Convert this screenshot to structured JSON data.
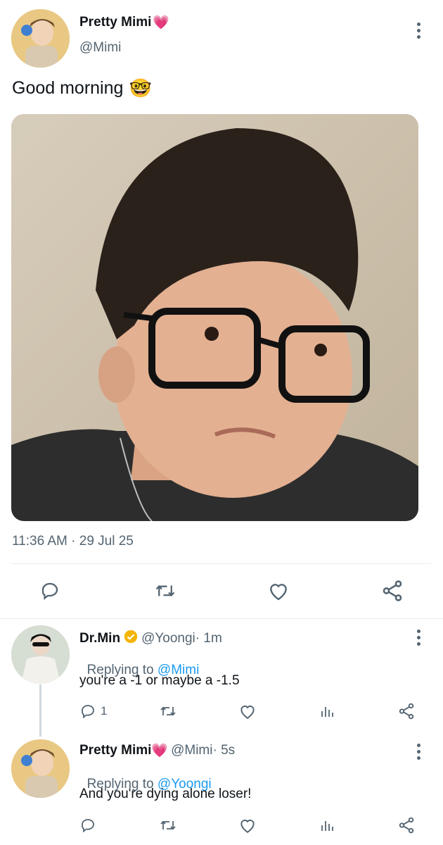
{
  "main_tweet": {
    "display_name": "Pretty Mimi",
    "name_emoji": "💗",
    "handle": "@Mimi",
    "text": "Good morning",
    "text_emoji": "🤓",
    "timestamp": "11:36 AM · 29 Jul 25",
    "photo_icon": "selfie-photo",
    "actions": [
      "reply-icon",
      "retweet-icon",
      "like-icon",
      "share-icon"
    ]
  },
  "replies": [
    {
      "display_name": "Dr.Min",
      "verified": true,
      "handle": "@Yoongi",
      "time": " · 1m",
      "replying_prefix": "Replying to ",
      "replying_handle": "@Mimi",
      "text": "you're a -1 or maybe a -1.5",
      "reply_count": "1"
    },
    {
      "display_name": "Pretty Mimi",
      "name_emoji": "💗",
      "handle": "@Mimi",
      "time": " · 5s",
      "replying_prefix": "Replying to ",
      "replying_handle": "@Yoongi",
      "text": "And you're dying alone loser!",
      "reply_count": ""
    }
  ],
  "colors": {
    "accent": "#1d9bf0",
    "secondary_text": "#536471",
    "verified_badge": "#f4b400"
  }
}
